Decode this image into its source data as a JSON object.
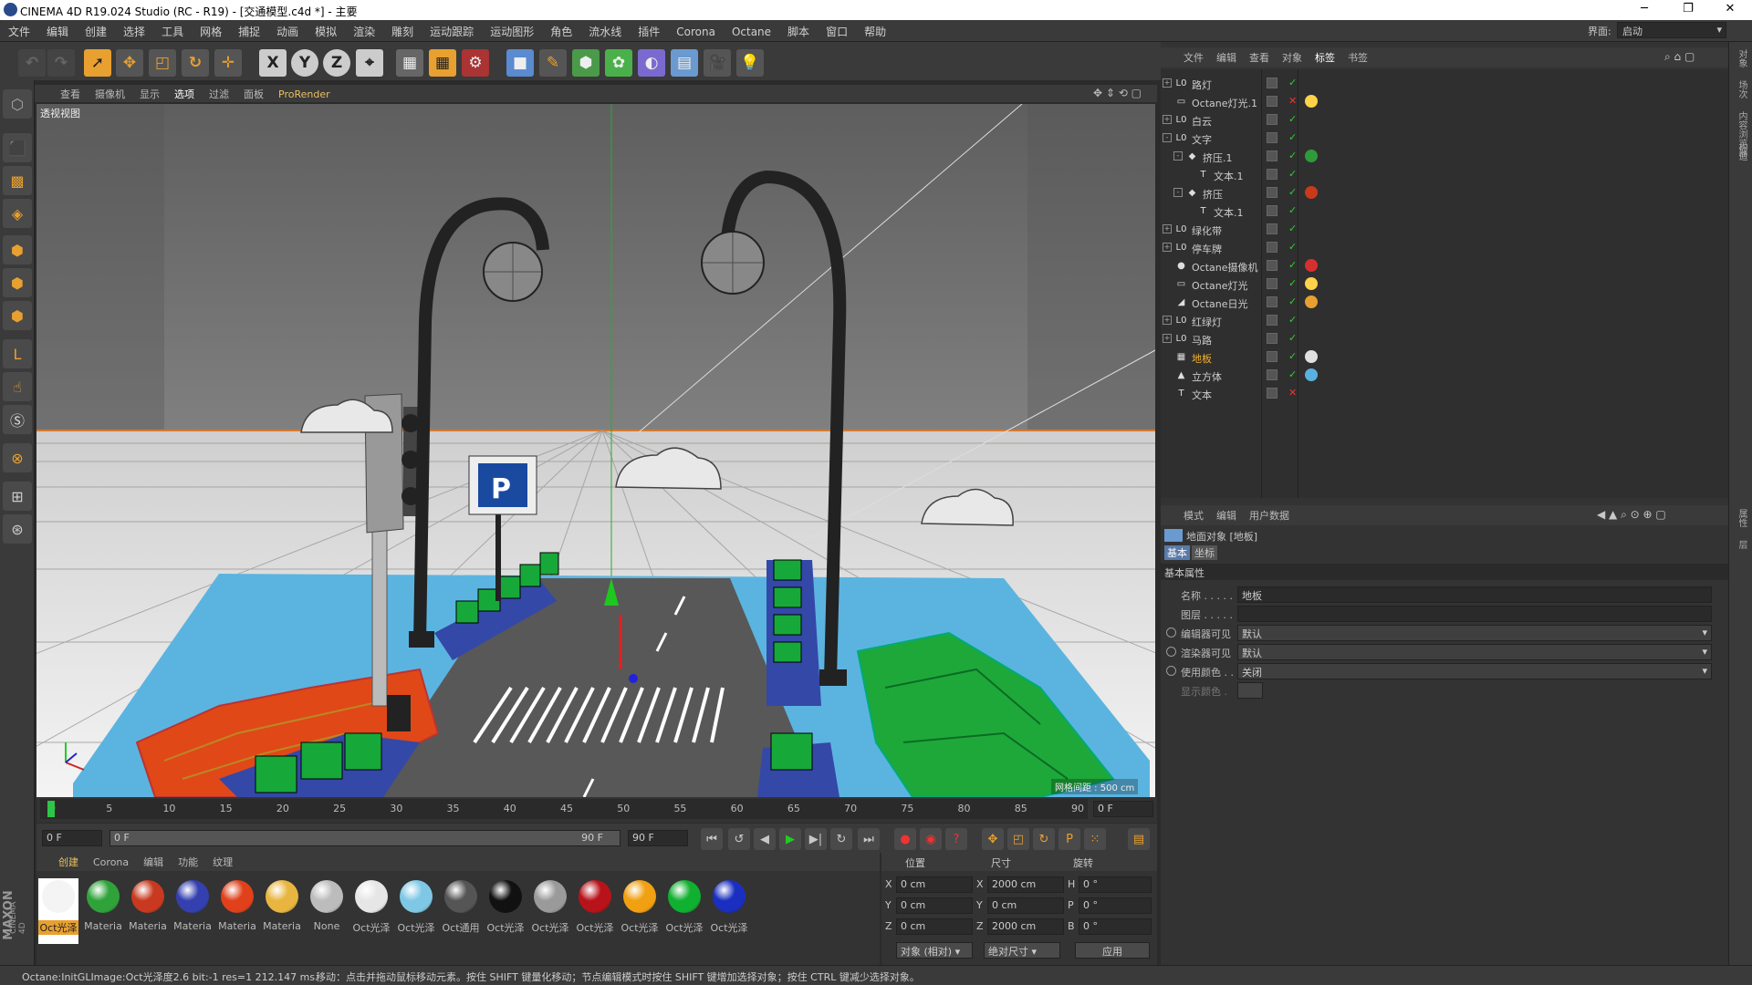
{
  "window": {
    "title": "CINEMA 4D R19.024 Studio (RC - R19) - [交通模型.c4d *] - 主要",
    "minimize": "─",
    "maximize": "❐",
    "close": "✕"
  },
  "menu": [
    "文件",
    "编辑",
    "创建",
    "选择",
    "工具",
    "网格",
    "捕捉",
    "动画",
    "模拟",
    "渲染",
    "雕刻",
    "运动跟踪",
    "运动图形",
    "角色",
    "流水线",
    "插件",
    "Corona",
    "Octane",
    "脚本",
    "窗口",
    "帮助"
  ],
  "layout": {
    "label": "界面:",
    "value": "启动"
  },
  "viewport": {
    "menu": [
      "查看",
      "摄像机",
      "显示",
      "选项",
      "过滤",
      "面板",
      "ProRender"
    ],
    "label": "透视视图",
    "grid_label": "网格间距 : 500 cm"
  },
  "timeline": {
    "ticks": [
      "0",
      "5",
      "10",
      "15",
      "20",
      "25",
      "30",
      "35",
      "40",
      "45",
      "50",
      "55",
      "60",
      "65",
      "70",
      "75",
      "80",
      "85",
      "90"
    ],
    "current": "0 F"
  },
  "transport": {
    "start": "0 F",
    "range_start": "0 F",
    "range_end": "90 F",
    "end": "90 F"
  },
  "materials": {
    "menu": [
      "创建",
      "Corona",
      "编辑",
      "功能",
      "纹理"
    ],
    "items": [
      {
        "label": "Oct光泽",
        "color": "#f4f4f4",
        "selected": true
      },
      {
        "label": "Materia",
        "color": "#2fa33a"
      },
      {
        "label": "Materia",
        "color": "#c9391f"
      },
      {
        "label": "Materia",
        "color": "#3440b0"
      },
      {
        "label": "Materia",
        "color": "#e0401a"
      },
      {
        "label": "Materia",
        "color": "#e8b640"
      },
      {
        "label": "None",
        "color": "#bcbcbc"
      },
      {
        "label": "Oct光泽",
        "color": "#e6e6e6"
      },
      {
        "label": "Oct光泽",
        "color": "#7ec8e6"
      },
      {
        "label": "Oct通用",
        "color": "#555555"
      },
      {
        "label": "Oct光泽",
        "color": "#111111"
      },
      {
        "label": "Oct光泽",
        "color": "#9a9a9a"
      },
      {
        "label": "Oct光泽",
        "color": "#b8121a"
      },
      {
        "label": "Oct光泽",
        "color": "#f0a010"
      },
      {
        "label": "Oct光泽",
        "color": "#10b030"
      },
      {
        "label": "Oct光泽",
        "color": "#1a2fc0"
      }
    ]
  },
  "coords": {
    "headers": [
      "位置",
      "尺寸",
      "旋转"
    ],
    "rows": [
      {
        "axis": "X",
        "pos": "0 cm",
        "size_axis": "X",
        "size": "2000 cm",
        "rot_axis": "H",
        "rot": "0 °"
      },
      {
        "axis": "Y",
        "pos": "0 cm",
        "size_axis": "Y",
        "size": "0 cm",
        "rot_axis": "P",
        "rot": "0 °"
      },
      {
        "axis": "Z",
        "pos": "0 cm",
        "size_axis": "Z",
        "size": "2000 cm",
        "rot_axis": "B",
        "rot": "0 °"
      }
    ],
    "mode": "对象 (相对)",
    "size_mode": "绝对尺寸",
    "apply": "应用"
  },
  "objects": {
    "menu": [
      "文件",
      "编辑",
      "查看",
      "对象",
      "标签",
      "书签"
    ],
    "items": [
      {
        "name": "路灯",
        "icon": "L0",
        "tw": "+"
      },
      {
        "name": "Octane灯光.1",
        "icon": "▭",
        "tw": ""
      },
      {
        "name": "白云",
        "icon": "L0",
        "tw": "+"
      },
      {
        "name": "文字",
        "icon": "L0",
        "tw": "-"
      },
      {
        "name": "挤压.1",
        "icon": "◆",
        "tw": "-",
        "indent": 1
      },
      {
        "name": "文本.1",
        "icon": "T",
        "tw": "",
        "indent": 2
      },
      {
        "name": "挤压",
        "icon": "◆",
        "tw": "-",
        "indent": 1
      },
      {
        "name": "文本.1",
        "icon": "T",
        "tw": "",
        "indent": 2
      },
      {
        "name": "绿化带",
        "icon": "L0",
        "tw": "+"
      },
      {
        "name": "停车牌",
        "icon": "L0",
        "tw": "+"
      },
      {
        "name": "Octane摄像机",
        "icon": "●",
        "tw": ""
      },
      {
        "name": "Octane灯光",
        "icon": "▭",
        "tw": ""
      },
      {
        "name": "Octane日光",
        "icon": "◢",
        "tw": ""
      },
      {
        "name": "红绿灯",
        "icon": "L0",
        "tw": "+"
      },
      {
        "name": "马路",
        "icon": "L0",
        "tw": "+"
      },
      {
        "name": "地板",
        "icon": "▦",
        "tw": "",
        "selected": true
      },
      {
        "name": "立方体",
        "icon": "▲",
        "tw": ""
      },
      {
        "name": "文本",
        "icon": "T",
        "tw": ""
      }
    ]
  },
  "attributes": {
    "menu": [
      "模式",
      "编辑",
      "用户数据"
    ],
    "object_title": "地面对象 [地板]",
    "tabs": [
      "基本",
      "坐标"
    ],
    "section": "基本属性",
    "fields": [
      {
        "label": "名称 . . . . .",
        "value": "地板",
        "radio": false
      },
      {
        "label": "图层 . . . . .",
        "value": "",
        "radio": false
      },
      {
        "label": "编辑器可见",
        "value": "默认",
        "radio": true
      },
      {
        "label": "渲染器可见",
        "value": "默认",
        "radio": true
      },
      {
        "label": "使用颜色 . .",
        "value": "关闭",
        "radio": true
      },
      {
        "label": "显示颜色 .",
        "value": "",
        "radio": false,
        "disabled": true
      }
    ]
  },
  "status": {
    "left": "Octane:InitGLImage:Oct光泽度2.6  bit:-1 res=1  212.147 ms.",
    "right": "移动：点击并拖动鼠标移动元素。按住 SHIFT 键量化移动；节点编辑模式时按住 SHIFT 键增加选择对象；按住 CTRL 键减少选择对象。"
  },
  "brand": {
    "maxon": "MAXON",
    "c4d": "CINEMA 4D"
  },
  "right_strip": [
    "对象",
    "场次",
    "内容浏览器",
    "构造"
  ],
  "right_strip_lower": [
    "属性",
    "层"
  ]
}
